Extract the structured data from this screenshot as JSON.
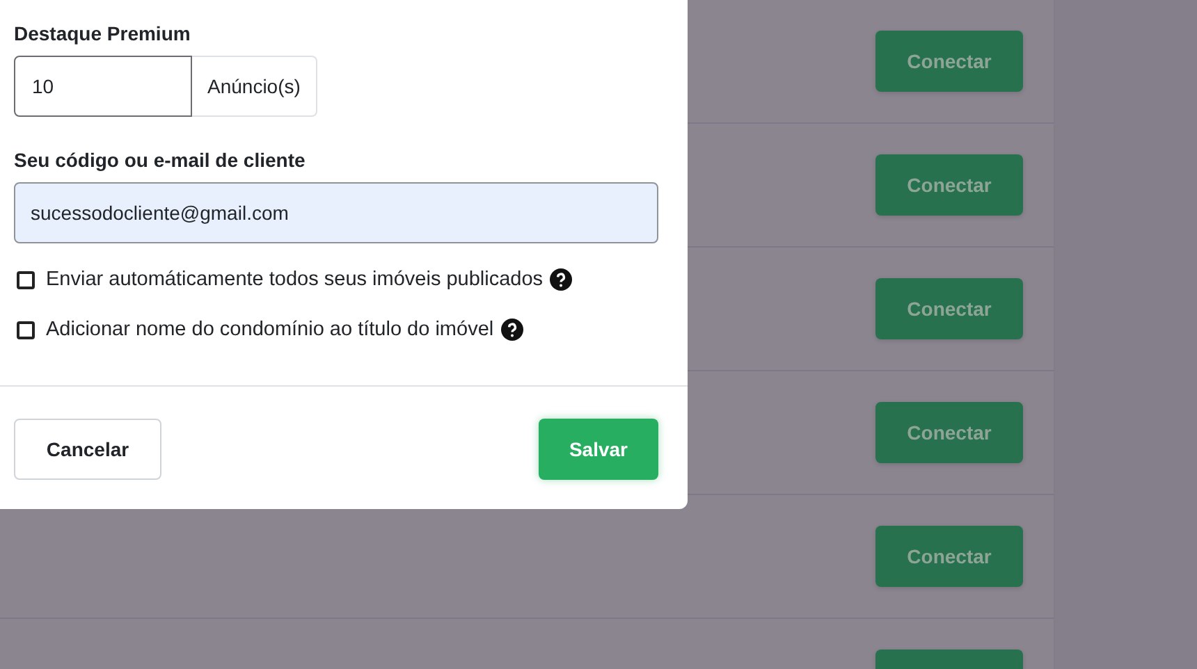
{
  "background_list": {
    "rows": [
      {
        "button": "Conectar"
      },
      {
        "button": "Conectar"
      },
      {
        "button": "Conectar"
      },
      {
        "button": "Conectar"
      },
      {
        "button": "Conectar"
      },
      {
        "button": ""
      }
    ]
  },
  "modal": {
    "premium": {
      "label": "Destaque Premium",
      "value": "10",
      "unit": "Anúncio(s)"
    },
    "client": {
      "label": "Seu código ou e-mail de cliente",
      "value": "sucessodocliente@gmail.com"
    },
    "options": [
      {
        "label": "Enviar automáticamente todos seus imóveis publicados",
        "checked": false,
        "help": true
      },
      {
        "label": "Adicionar nome do condomínio ao título do imóvel",
        "checked": false,
        "help": true
      }
    ],
    "buttons": [
      {
        "label": "Cancelar",
        "kind": "secondary"
      },
      {
        "label": "Salvar",
        "kind": "primary"
      }
    ]
  }
}
